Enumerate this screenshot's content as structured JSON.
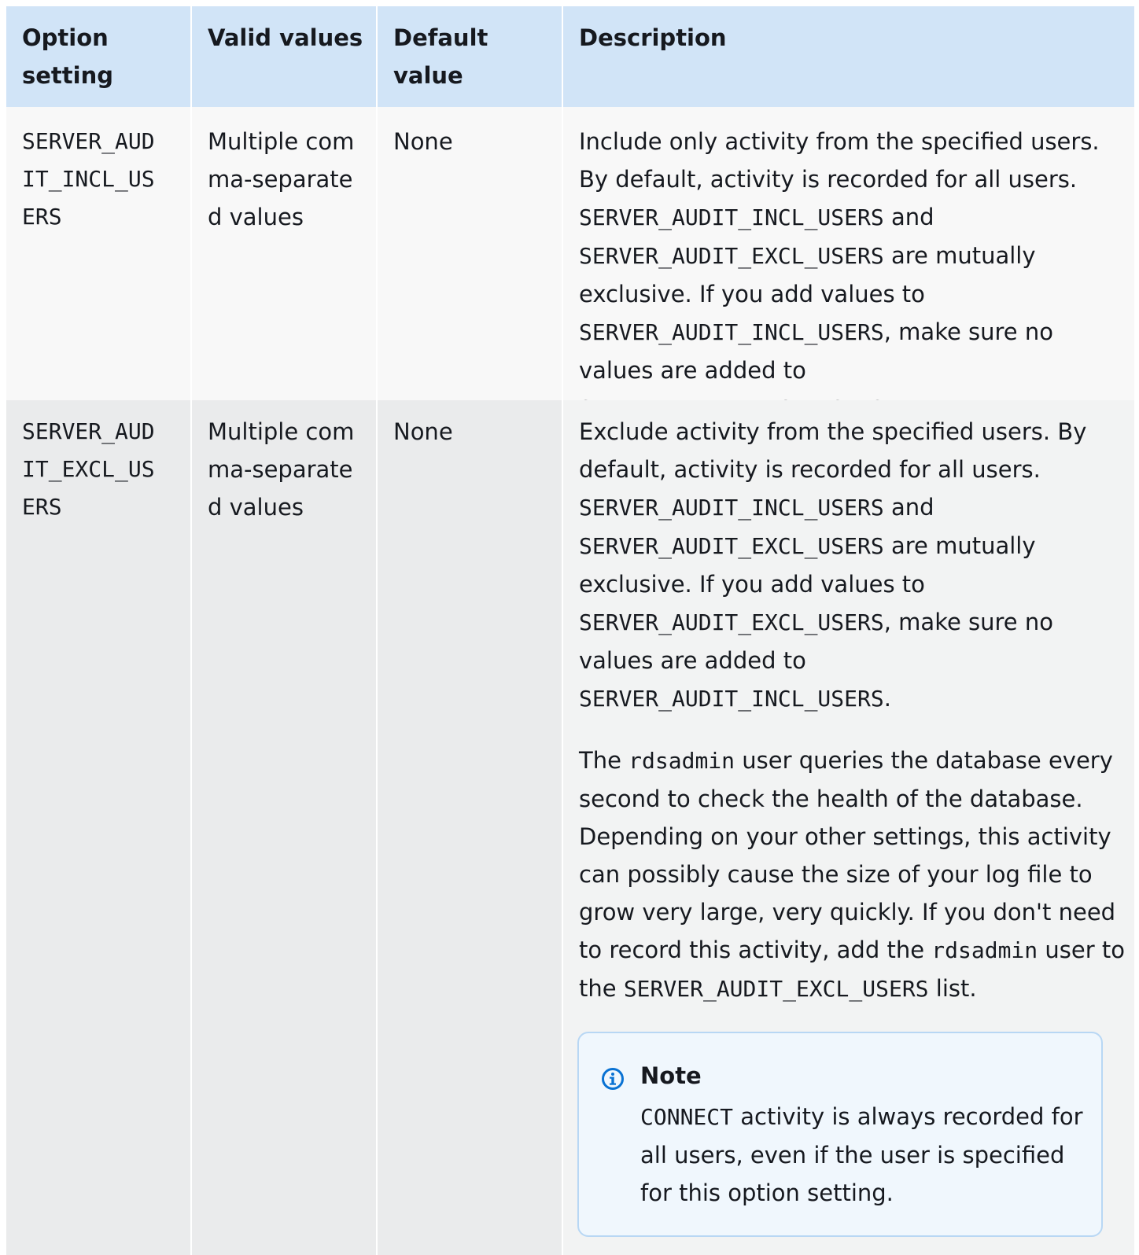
{
  "table": {
    "headers": [
      "Option setting",
      "Valid values",
      "Default value",
      "Description"
    ],
    "rows": [
      {
        "option": "SERVER_AUDIT_INCL_USERS",
        "valid_values": "Multiple comma-separated values",
        "default": "None",
        "description": {
          "p1_prefix": "Include only activity from the specified users. By default, activity is recorded for all users. ",
          "code1": "SERVER_AUDIT_INCL_USERS",
          "p1_and": " and ",
          "code2": "SERVER_AUDIT_EXCL_USERS",
          "p1_mid": " are mutually exclusive. If you add values to ",
          "code3": "SERVER_AUDIT_INCL_USERS",
          "p1_mid2": ", make sure no values are added to ",
          "code4": "SERVER_AUDIT_EXCL_USERS",
          "p1_end": "."
        }
      },
      {
        "option": "SERVER_AUDIT_EXCL_USERS",
        "valid_values": "Multiple comma-separated values",
        "default": "None",
        "description": {
          "p1_prefix": "Exclude activity from the specified users. By default, activity is recorded for all users. ",
          "code1": "SERVER_AUDIT_INCL_USERS",
          "p1_and": " and ",
          "code2": "SERVER_AUDIT_EXCL_USERS",
          "p1_mid": " are mutually exclusive. If you add values to ",
          "code3": "SERVER_AUDIT_EXCL_USERS",
          "p1_mid2": ", make sure no values are added to ",
          "code4": "SERVER_AUDIT_INCL_USERS",
          "p1_end": ".",
          "p2_a": "The ",
          "p2_code1": "rdsadmin",
          "p2_b": " user queries the database every second to check the health of the database. Depending on your other settings, this activity can possibly cause the size of your log file to grow very large, very quickly. If you don't need to record this activity, add the ",
          "p2_code2": "rdsadmin",
          "p2_c": " user to the ",
          "p2_code3": "SERVER_AUDIT_EXCL_USERS",
          "p2_d": " list.",
          "note_title": "Note",
          "note_code": "CONNECT",
          "note_text": " activity is always recorded for all users, even if the user is specified for this option setting."
        }
      }
    ]
  },
  "icons": {
    "note_icon": "info-circle-icon"
  },
  "colors": {
    "header_bg": "#d1e4f7",
    "note_border": "#b8d7f4",
    "note_icon": "#0972d3"
  }
}
